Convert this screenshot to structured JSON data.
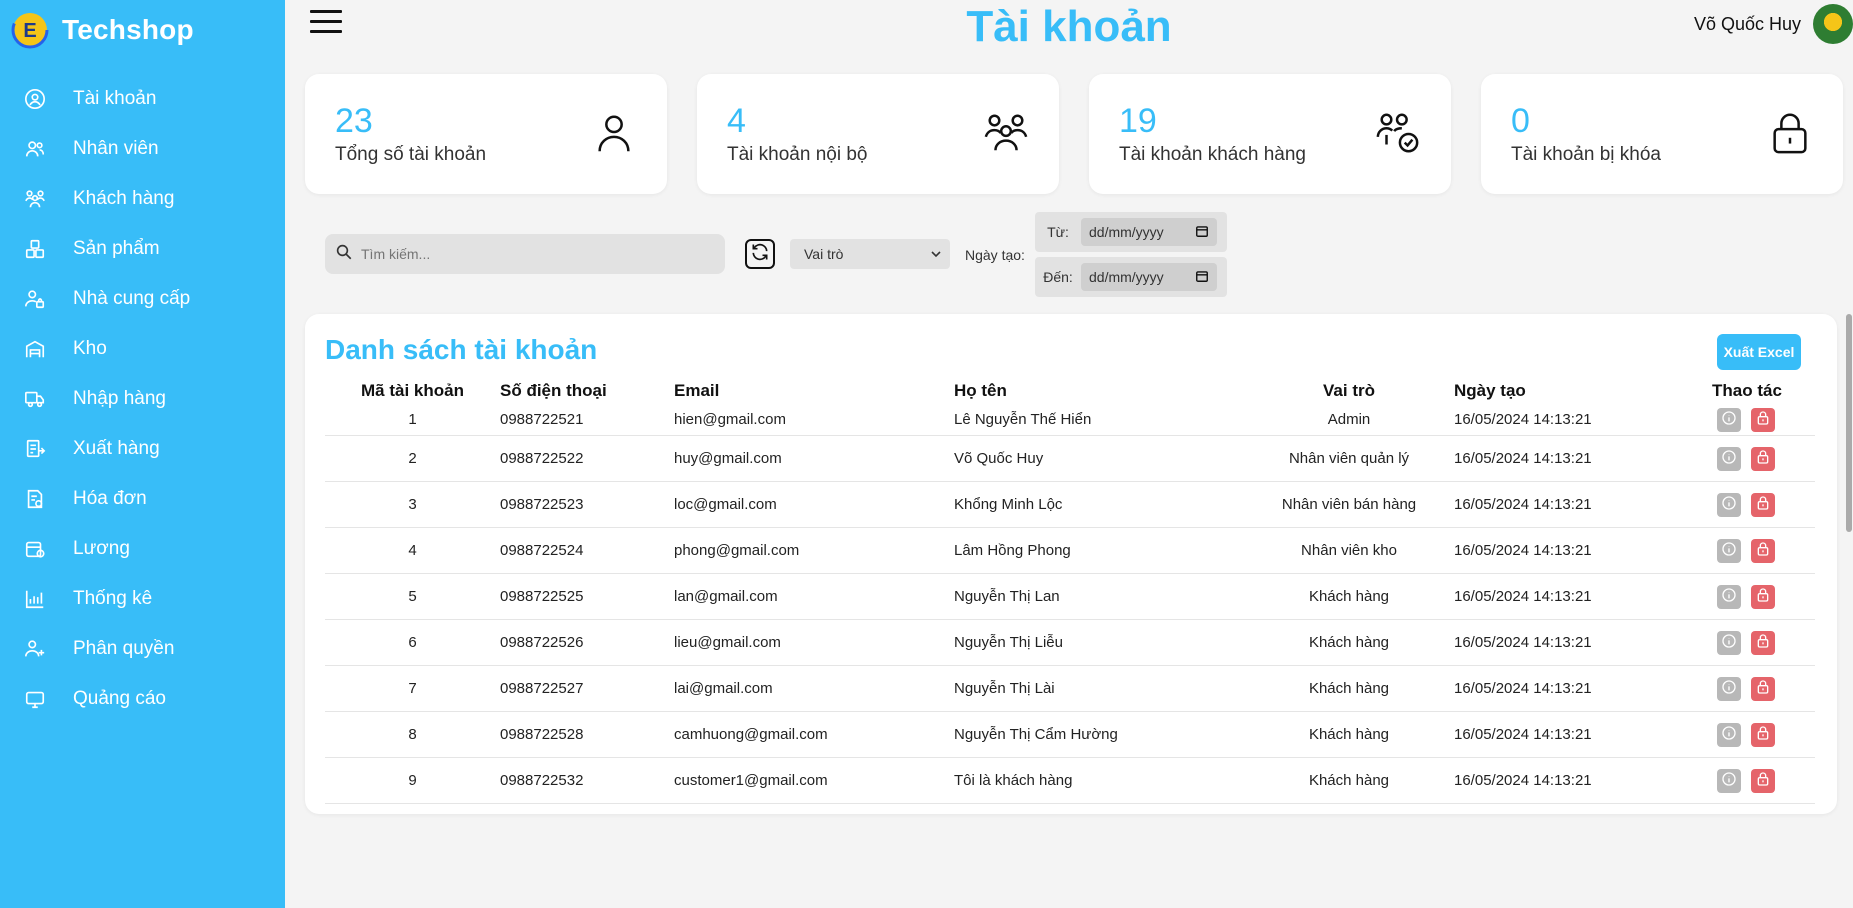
{
  "brand": {
    "name": "Techshop",
    "logo_icon": "techshop-logo-icon"
  },
  "sidebar": {
    "items": [
      {
        "label": "Tài khoản",
        "icon": "user-circle-icon"
      },
      {
        "label": "Nhân viên",
        "icon": "users-icon"
      },
      {
        "label": "Khách hàng",
        "icon": "group-icon"
      },
      {
        "label": "Sản phẩm",
        "icon": "boxes-icon"
      },
      {
        "label": "Nhà cung cấp",
        "icon": "supplier-icon"
      },
      {
        "label": "Kho",
        "icon": "warehouse-icon"
      },
      {
        "label": "Nhập hàng",
        "icon": "truck-icon"
      },
      {
        "label": "Xuất hàng",
        "icon": "export-icon"
      },
      {
        "label": "Hóa đơn",
        "icon": "invoice-icon"
      },
      {
        "label": "Lương",
        "icon": "wallet-icon"
      },
      {
        "label": "Thống kê",
        "icon": "chart-icon"
      },
      {
        "label": "Phân quyền",
        "icon": "user-plus-icon"
      },
      {
        "label": "Quảng cáo",
        "icon": "monitor-icon"
      }
    ]
  },
  "header": {
    "title": "Tài khoản",
    "user_name": "Võ Quốc Huy"
  },
  "stats": [
    {
      "value": "23",
      "label": "Tổng số tài khoản",
      "icon": "user-icon"
    },
    {
      "value": "4",
      "label": "Tài khoản nội bộ",
      "icon": "users-icon"
    },
    {
      "value": "19",
      "label": "Tài khoản khách hàng",
      "icon": "users-check-icon"
    },
    {
      "value": "0",
      "label": "Tài khoản bị khóa",
      "icon": "lock-icon"
    }
  ],
  "filters": {
    "search_placeholder": "Tìm kiếm...",
    "role_label": "Vai trò",
    "created_label": "Ngày tạo:",
    "from_label": "Từ:",
    "to_label": "Đến:",
    "date_placeholder": "dd/mm/yyyy"
  },
  "list": {
    "title": "Danh sách tài khoản",
    "export_label": "Xuất Excel",
    "columns": [
      "Mã tài khoản",
      "Số điện thoại",
      "Email",
      "Họ tên",
      "Vai trò",
      "Ngày tạo",
      "Thao tác"
    ],
    "rows": [
      {
        "id": "1",
        "phone": "0988722521",
        "email": "hien@gmail.com",
        "name": "Lê Nguyễn Thế Hiển",
        "role": "Admin",
        "created": "16/05/2024 14:13:21"
      },
      {
        "id": "2",
        "phone": "0988722522",
        "email": "huy@gmail.com",
        "name": "Võ Quốc Huy",
        "role": "Nhân viên quản lý",
        "created": "16/05/2024 14:13:21"
      },
      {
        "id": "3",
        "phone": "0988722523",
        "email": "loc@gmail.com",
        "name": "Khổng Minh Lộc",
        "role": "Nhân viên bán hàng",
        "created": "16/05/2024 14:13:21"
      },
      {
        "id": "4",
        "phone": "0988722524",
        "email": "phong@gmail.com",
        "name": "Lâm Hồng Phong",
        "role": "Nhân viên kho",
        "created": "16/05/2024 14:13:21"
      },
      {
        "id": "5",
        "phone": "0988722525",
        "email": "lan@gmail.com",
        "name": "Nguyễn Thị Lan",
        "role": "Khách hàng",
        "created": "16/05/2024 14:13:21"
      },
      {
        "id": "6",
        "phone": "0988722526",
        "email": "lieu@gmail.com",
        "name": "Nguyễn Thị Liễu",
        "role": "Khách hàng",
        "created": "16/05/2024 14:13:21"
      },
      {
        "id": "7",
        "phone": "0988722527",
        "email": "lai@gmail.com",
        "name": "Nguyễn Thị Lài",
        "role": "Khách hàng",
        "created": "16/05/2024 14:13:21"
      },
      {
        "id": "8",
        "phone": "0988722528",
        "email": "camhuong@gmail.com",
        "name": "Nguyễn Thị Cẩm Hường",
        "role": "Khách hàng",
        "created": "16/05/2024 14:13:21"
      },
      {
        "id": "9",
        "phone": "0988722532",
        "email": "customer1@gmail.com",
        "name": "Tôi là khách hàng",
        "role": "Khách hàng",
        "created": "16/05/2024 14:13:21"
      }
    ]
  },
  "colors": {
    "accent": "#38bdf8",
    "lock_action": "#e5646a",
    "info_action": "#b8b8b8"
  }
}
